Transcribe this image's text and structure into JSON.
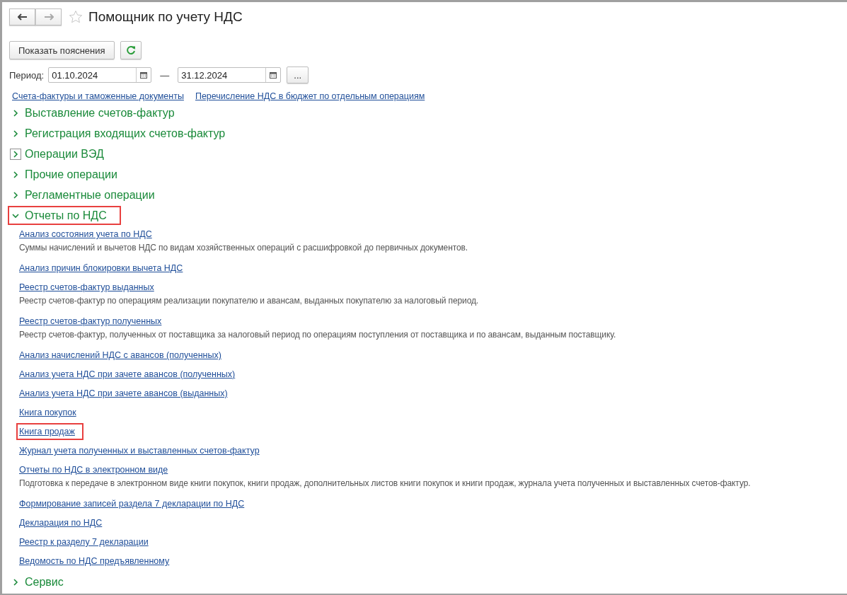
{
  "window": {
    "title": "Помощник по учету НДС",
    "favorite": false
  },
  "toolbar": {
    "explain_button": "Показать пояснения"
  },
  "period": {
    "label": "Период:",
    "start": "01.10.2024",
    "separator": "—",
    "end": "31.12.2024",
    "more_button": "..."
  },
  "top_links": [
    "Счета-фактуры и таможенные документы",
    "Перечисление НДС в бюджет по отдельным операциям"
  ],
  "sections": [
    {
      "title": "Выставление счетов-фактур",
      "expanded": false,
      "focused": false,
      "highlighted": false
    },
    {
      "title": "Регистрация входящих счетов-фактур",
      "expanded": false,
      "focused": false,
      "highlighted": false
    },
    {
      "title": "Операции ВЭД",
      "expanded": false,
      "focused": true,
      "highlighted": false
    },
    {
      "title": "Прочие операции",
      "expanded": false,
      "focused": false,
      "highlighted": false
    },
    {
      "title": "Регламентные операции",
      "expanded": false,
      "focused": false,
      "highlighted": false
    },
    {
      "title": "Отчеты по НДС",
      "expanded": true,
      "focused": false,
      "highlighted": true,
      "items": [
        {
          "link": "Анализ состояния учета по НДС",
          "description": "Суммы начислений и вычетов НДС по видам хозяйственных операций с расшифровкой до первичных документов.",
          "highlighted": false
        },
        {
          "link": "Анализ причин блокировки вычета НДС",
          "highlighted": false
        },
        {
          "link": "Реестр счетов-фактур выданных",
          "description": "Реестр счетов-фактур по операциям реализации покупателю и авансам, выданных покупателю за налоговый период.",
          "highlighted": false
        },
        {
          "link": "Реестр счетов-фактур полученных",
          "description": "Реестр счетов-фактур, полученных от поставщика за налоговый период по операциям поступления от поставщика и по авансам, выданным поставщику.",
          "highlighted": false
        },
        {
          "link": "Анализ начислений НДС с авансов (полученных)",
          "highlighted": false
        },
        {
          "link": "Анализ учета НДС при зачете авансов (полученных)",
          "highlighted": false
        },
        {
          "link": "Анализ учета НДС при зачете авансов (выданных)",
          "highlighted": false
        },
        {
          "link": "Книга покупок",
          "highlighted": false
        },
        {
          "link": "Книга продаж",
          "highlighted": true
        },
        {
          "link": "Журнал учета полученных и выставленных счетов-фактур",
          "highlighted": false
        },
        {
          "link": "Отчеты по НДС в электронном виде",
          "description": "Подготовка к передаче в электронном виде книги покупок, книги продаж, дополнительных листов книги покупок и книги продаж, журнала учета полученных и выставленных счетов-фактур.",
          "highlighted": false
        },
        {
          "link": "Формирование записей раздела 7 декларации по НДС",
          "highlighted": false
        },
        {
          "link": "Декларация по НДС",
          "highlighted": false
        },
        {
          "link": "Реестр к разделу 7 декларации",
          "highlighted": false
        },
        {
          "link": "Ведомость по НДС предъявленному",
          "highlighted": false
        }
      ]
    },
    {
      "title": "Сервис",
      "expanded": false,
      "focused": false,
      "highlighted": false
    }
  ]
}
